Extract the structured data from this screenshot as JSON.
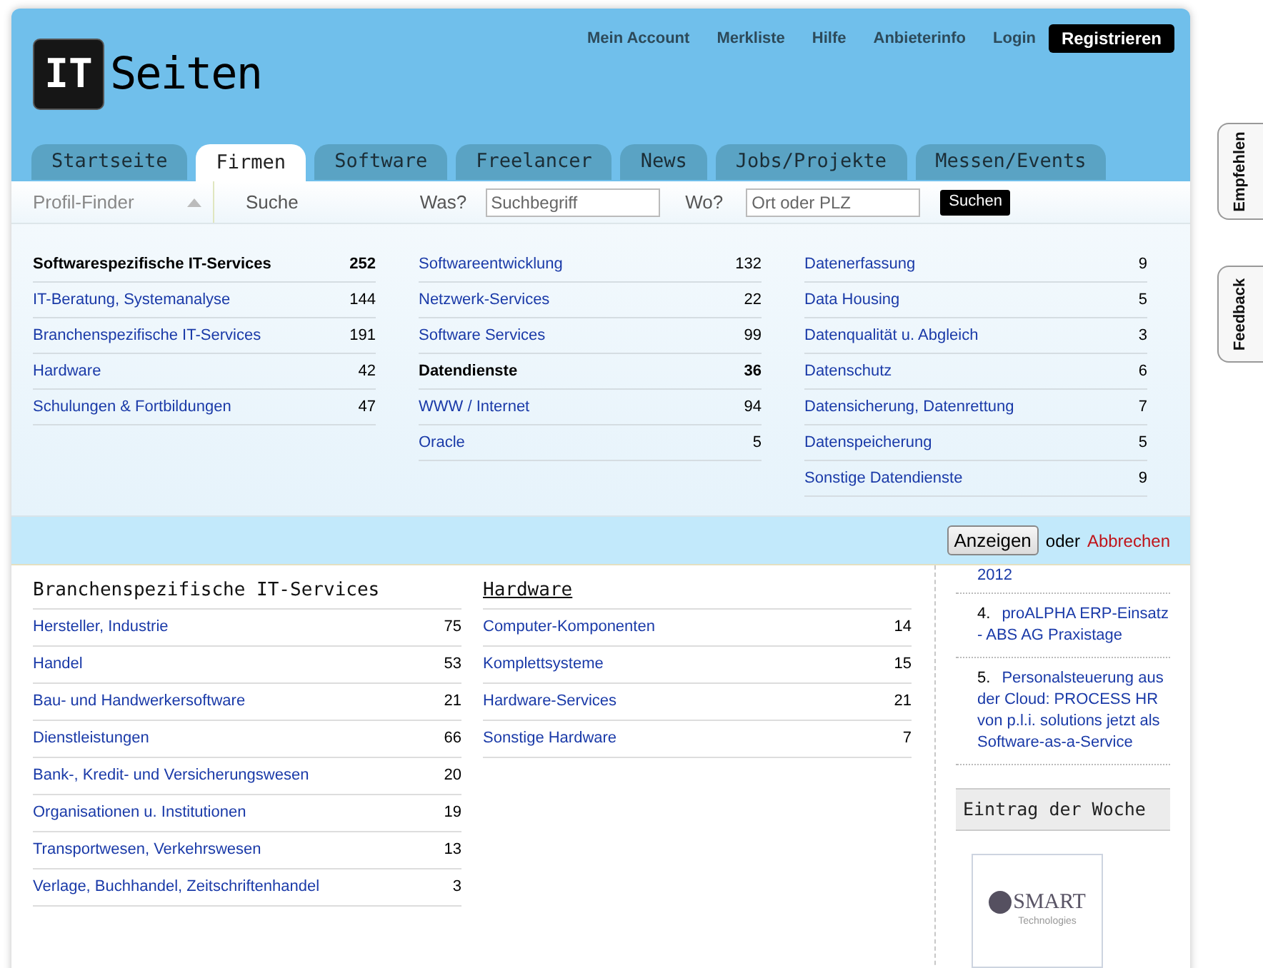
{
  "logo": {
    "mark": "IT",
    "name": "Seiten"
  },
  "top_nav": {
    "links": [
      "Mein Account",
      "Merkliste",
      "Hilfe",
      "Anbieterinfo",
      "Login"
    ],
    "register": "Registrieren"
  },
  "tabs": [
    {
      "label": "Startseite",
      "selected": false
    },
    {
      "label": "Firmen",
      "selected": true
    },
    {
      "label": "Software",
      "selected": false
    },
    {
      "label": "Freelancer",
      "selected": false
    },
    {
      "label": "News",
      "selected": false
    },
    {
      "label": "Jobs/Projekte",
      "selected": false
    },
    {
      "label": "Messen/Events",
      "selected": false
    }
  ],
  "finder": {
    "label": "Profil-Finder",
    "search_label": "Suche",
    "what_label": "Was?",
    "what_placeholder": "Suchbegriff",
    "where_label": "Wo?",
    "where_placeholder": "Ort oder PLZ",
    "button": "Suchen"
  },
  "categories": [
    [
      {
        "label": "Softwarespezifische IT-Services",
        "count": "252",
        "selected": true
      },
      {
        "label": "IT-Beratung, Systemanalyse",
        "count": "144",
        "selected": false
      },
      {
        "label": "Branchenspezifische IT-Services",
        "count": "191",
        "selected": false
      },
      {
        "label": "Hardware",
        "count": "42",
        "selected": false
      },
      {
        "label": "Schulungen & Fortbildungen",
        "count": "47",
        "selected": false
      }
    ],
    [
      {
        "label": "Softwareentwicklung",
        "count": "132",
        "selected": false
      },
      {
        "label": "Netzwerk-Services",
        "count": "22",
        "selected": false
      },
      {
        "label": "Software Services",
        "count": "99",
        "selected": false
      },
      {
        "label": "Datendienste",
        "count": "36",
        "selected": true
      },
      {
        "label": "WWW / Internet",
        "count": "94",
        "selected": false
      },
      {
        "label": "Oracle",
        "count": "5",
        "selected": false
      }
    ],
    [
      {
        "label": "Datenerfassung",
        "count": "9",
        "selected": false
      },
      {
        "label": "Data Housing",
        "count": "5",
        "selected": false
      },
      {
        "label": "Datenqualität u. Abgleich",
        "count": "3",
        "selected": false
      },
      {
        "label": "Datenschutz",
        "count": "6",
        "selected": false
      },
      {
        "label": "Datensicherung, Datenrettung",
        "count": "7",
        "selected": false
      },
      {
        "label": "Datenspeicherung",
        "count": "5",
        "selected": false
      },
      {
        "label": "Sonstige Datendienste",
        "count": "9",
        "selected": false
      }
    ]
  ],
  "action_bar": {
    "button": "Anzeigen",
    "or": "oder",
    "cancel": "Abbrechen"
  },
  "sections": [
    {
      "title": "Branchenspezifische IT-Services",
      "underlined": false,
      "rows": [
        {
          "label": "Hersteller, Industrie",
          "count": "75"
        },
        {
          "label": "Handel",
          "count": "53"
        },
        {
          "label": "Bau- und Handwerkersoftware",
          "count": "21"
        },
        {
          "label": "Dienstleistungen",
          "count": "66"
        },
        {
          "label": "Bank-, Kredit- und Versicherungswesen",
          "count": "20"
        },
        {
          "label": "Organisationen u. Institutionen",
          "count": "19"
        },
        {
          "label": "Transportwesen, Verkehrswesen",
          "count": "13"
        },
        {
          "label": "Verlage, Buchhandel, Zeitschriftenhandel",
          "count": "3"
        }
      ]
    },
    {
      "title": "Hardware",
      "underlined": true,
      "rows": [
        {
          "label": "Computer-Komponenten",
          "count": "14"
        },
        {
          "label": "Komplettsysteme",
          "count": "15"
        },
        {
          "label": "Hardware-Services",
          "count": "21"
        },
        {
          "label": "Sonstige Hardware",
          "count": "7"
        }
      ]
    }
  ],
  "news": {
    "partial": "2012",
    "items": [
      {
        "number": "4.",
        "text": "proALPHA ERP-Einsatz - ABS AG Praxistage"
      },
      {
        "number": "5.",
        "text": "Personalsteuerung aus der Cloud: PROCESS HR von p.l.i. solutions jetzt als Software-as-a-Service"
      }
    ]
  },
  "featured": {
    "title": "Eintrag der Woche",
    "logo_name": "SMART",
    "logo_tagline": "Technologies"
  },
  "side_tabs": [
    "Empfehlen",
    "Feedback"
  ]
}
